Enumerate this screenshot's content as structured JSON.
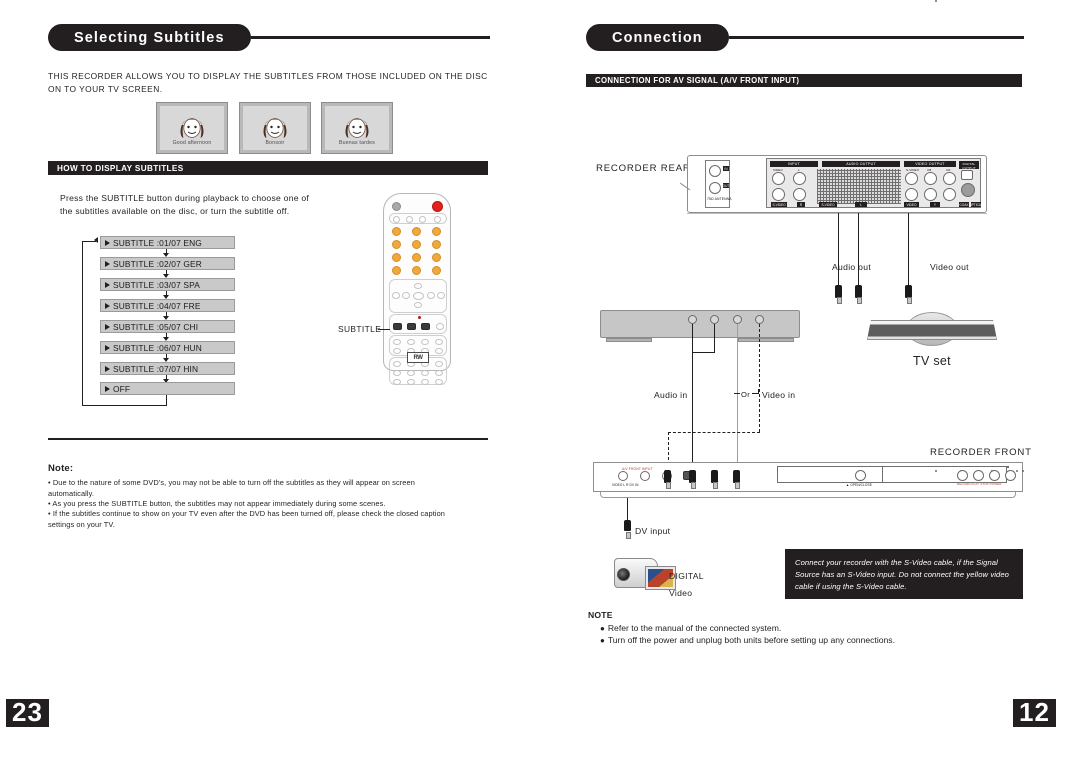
{
  "left_page": {
    "section_title": "Selecting Subtitles",
    "intro": "THIS RECORDER ALLOWS YOU TO DISPLAY THE SUBTITLES FROM THOSE INCLUDED ON THE DISC ON TO YOUR TV SCREEN.",
    "tv_samples": [
      {
        "caption": "Good afternoon"
      },
      {
        "caption": "Bonsoir"
      },
      {
        "caption": "Buenas tardes"
      }
    ],
    "howto_band": "HOW TO DISPLAY SUBTITLES",
    "howto_text": "Press the SUBTITLE button during playback to choose one of the subtitles available on the disc, or turn the subtitle off.",
    "subtitle_cycle": [
      "SUBTITLE :01/07 ENG",
      "SUBTITLE :02/07 GER",
      "SUBTITLE :03/07 SPA",
      "SUBTITLE :04/07 FRE",
      "SUBTITLE :05/07 CHI",
      "SUBTITLE :06/07 HUN",
      "SUBTITLE :07/07 HIN",
      "OFF"
    ],
    "remote_callout": "SUBTITLE",
    "remote_logo": "RW",
    "note": {
      "title": "Note:",
      "items": [
        "• Due to the nature of some DVD's, you may not be able to turn off the subtitles as they will appear on screen automatically.",
        "• As you press the SUBTITLE button, the subtitles may not appear immediately during some scenes.",
        "• If the subtitles continue to show on your TV even after the DVD has been turned off, please check the closed caption settings on your TV."
      ]
    },
    "page_number": "23"
  },
  "right_page": {
    "section_title": "Connection",
    "band": "CONNECTION FOR AV SIGNAL (A/V FRONT INPUT)",
    "recorder_rear_label": "RECORDER REAR",
    "recorder_front_label": "RECORDER FRONT",
    "rear_panel_groups": [
      "INPUT",
      "AUDIO OUTPUT",
      "VIDEO OUTPUT",
      "DIGITAL OUTPUT"
    ],
    "rear_small_labels": [
      "VIDEO",
      "L",
      "R",
      "S-VIDEO",
      "VIDEO",
      "COAX",
      "OPTICAL",
      "75Ω ANTENNA"
    ],
    "audio_out_label": "Audio out",
    "video_out_label": "Video out",
    "tv_set_label": "TV set",
    "audio_in_label": "Audio in",
    "or_label": "Or",
    "video_in_label": "Video in",
    "dv_input_label": "DV input",
    "digital_label": "DIGITAL",
    "video_label": "Video",
    "svideo_note": "Connect your recorder with the S-Video cable, if the Signal Source has an S-Video input. Do not connect the yellow video cable if using the S-Video cable.",
    "note": {
      "title": "NOTE",
      "items": [
        "Refer to the manual of the connected system.",
        "Turn off the power and unplug both units before setting up any connections."
      ]
    },
    "page_number": "12"
  },
  "colors": {
    "ink": "#231f20",
    "amber": "#f2a93b",
    "red": "#e2211c",
    "panel_gray": "#c9c9c9"
  }
}
